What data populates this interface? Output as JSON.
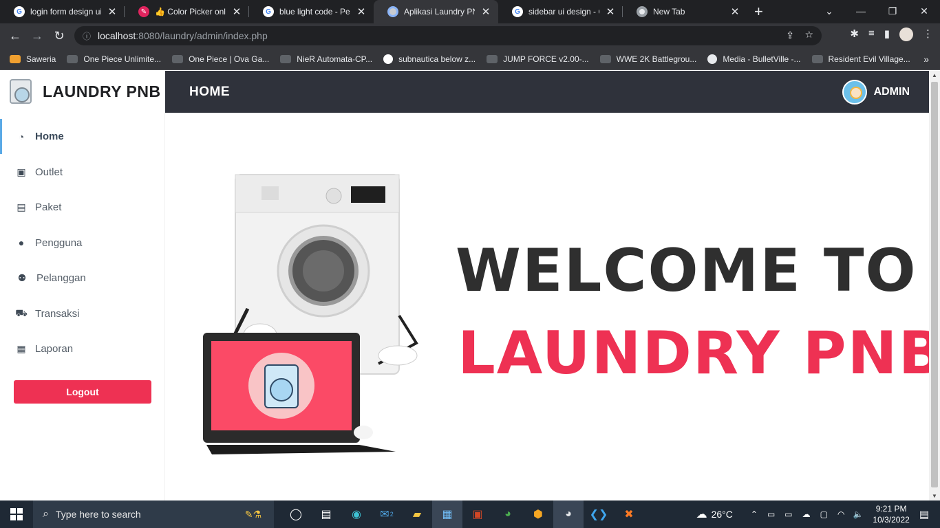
{
  "browser": {
    "tabs": [
      {
        "title": "login form design ui -",
        "icon": "google-icon",
        "active": false
      },
      {
        "title": "👍 Color Picker online",
        "icon": "colorpicker-icon",
        "active": false
      },
      {
        "title": "blue light code - Pene",
        "icon": "google-icon",
        "active": false
      },
      {
        "title": "Aplikasi Laundry PNB",
        "icon": "page-icon",
        "active": true
      },
      {
        "title": "sidebar ui design - Go",
        "icon": "google-icon",
        "active": false
      },
      {
        "title": "New Tab",
        "icon": "chrome-icon",
        "active": false
      }
    ],
    "url_host": "localhost",
    "url_path": ":8080/laundry/admin/index.php",
    "bookmarks": [
      "Saweria",
      "One Piece Unlimite...",
      "One Piece | Ova Ga...",
      "NieR Automata-CP...",
      "subnautica below z...",
      "JUMP FORCE v2.00-...",
      "WWE 2K Battlegrou...",
      "Media - BulletVille -...",
      "Resident Evil Village..."
    ]
  },
  "app": {
    "brand": "LAUNDRY PNB",
    "page_title": "HOME",
    "user": "ADMIN",
    "menu": [
      {
        "label": "Home",
        "icon": "dashboard-icon",
        "active": true
      },
      {
        "label": "Outlet",
        "icon": "briefcase-icon",
        "active": false
      },
      {
        "label": "Paket",
        "icon": "archive-box-icon",
        "active": false
      },
      {
        "label": "Pengguna",
        "icon": "user-icon",
        "active": false
      },
      {
        "label": "Pelanggan",
        "icon": "users-icon",
        "active": false
      },
      {
        "label": "Transaksi",
        "icon": "cart-icon",
        "active": false
      },
      {
        "label": "Laporan",
        "icon": "document-icon",
        "active": false
      }
    ],
    "logout_label": "Logout",
    "welcome_line1": "WELCOME TO",
    "welcome_line2": "LAUNDRY PNB",
    "colors": {
      "accent": "#ee3153",
      "topbar": "#2f323b",
      "active_marker": "#5aa9e6"
    }
  },
  "taskbar": {
    "search_placeholder": "Type here to search",
    "weather": "26°C",
    "time": "9:21 PM",
    "date": "10/3/2022",
    "mail_badge": "2"
  }
}
